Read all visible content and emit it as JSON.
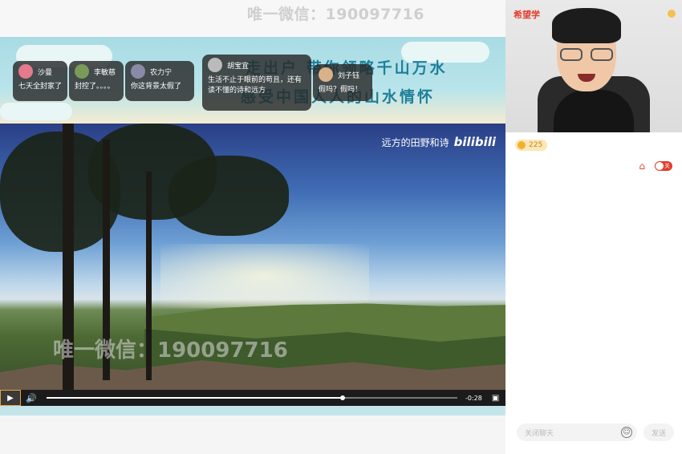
{
  "watermark": {
    "top": "唯一微信：190097716",
    "mid": "唯一微信：190097716"
  },
  "slide": {
    "title_line1": "走出户 带你领略千山万水",
    "title_line2": "感受中国人人的山水情怀",
    "photo_caption": "远方的田野和诗",
    "photo_brand": "bilibili"
  },
  "danmaku": [
    {
      "user": "沙曼",
      "msg": "七天全封家了",
      "avatar_color": "#e57a8a"
    },
    {
      "user": "李敏慈",
      "msg": "封控了。。。。",
      "avatar_color": "#7a9a5a"
    },
    {
      "user": "农力宁",
      "msg": "你这背景太假了",
      "avatar_color": "#8a8aa8"
    },
    {
      "user": "胡宝宜",
      "msg": "生活不止于眼前的苟且，还有\n读不懂的诗和远方",
      "avatar_color": "#bbbbbb"
    },
    {
      "user": "刘子钰",
      "msg": "假吗？假吗！",
      "avatar_color": "#d9b28a"
    }
  ],
  "player": {
    "play_icon": "play-icon",
    "volume_icon": "volume-icon",
    "time": "-0:28",
    "progress": 0.72
  },
  "right": {
    "cam_logo": "希望学",
    "coins": "225",
    "toggle_label": "关",
    "chat_placeholder": "关闭聊天",
    "send_label": "发送"
  },
  "colors": {
    "accent": "#e23a2a",
    "coin": "#f2b12b"
  }
}
